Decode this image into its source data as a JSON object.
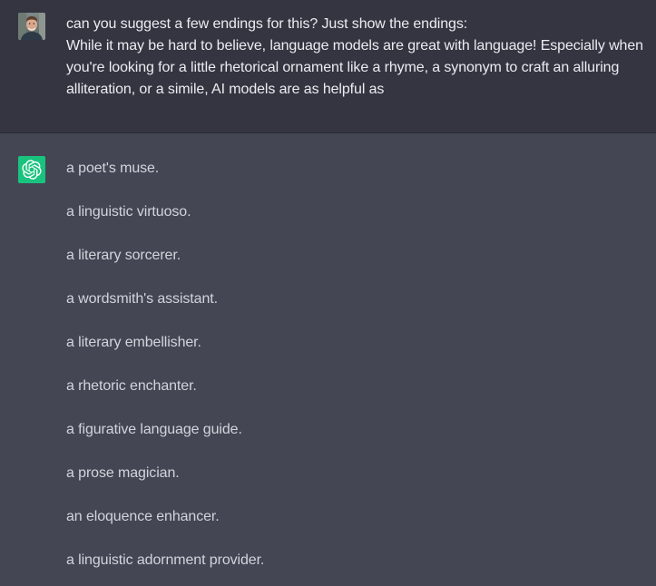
{
  "conversation": {
    "user_message": {
      "avatar": "user-photo-avatar",
      "lines": [
        "can you suggest a few endings for this? Just show the endings:",
        "While it may be hard to believe, language models are great with language! Especially when",
        "you're looking for a little rhetorical ornament like a rhyme, a synonym to craft an alluring",
        "alliteration, or a simile, AI models are as helpful as"
      ]
    },
    "assistant_message": {
      "avatar": "openai-logo-icon",
      "endings": [
        "a poet's muse.",
        "a linguistic virtuoso.",
        "a literary sorcerer.",
        "a wordsmith's assistant.",
        "a literary embellisher.",
        "a rhetoric enchanter.",
        "a figurative language guide.",
        "a prose magician.",
        "an eloquence enhancer.",
        "a linguistic adornment provider."
      ]
    }
  },
  "colors": {
    "user_bg": "#343541",
    "assistant_bg": "#444654",
    "avatar_bot": "#19c37d",
    "text_user": "#ececf1",
    "text_assistant": "#d1d5db"
  }
}
